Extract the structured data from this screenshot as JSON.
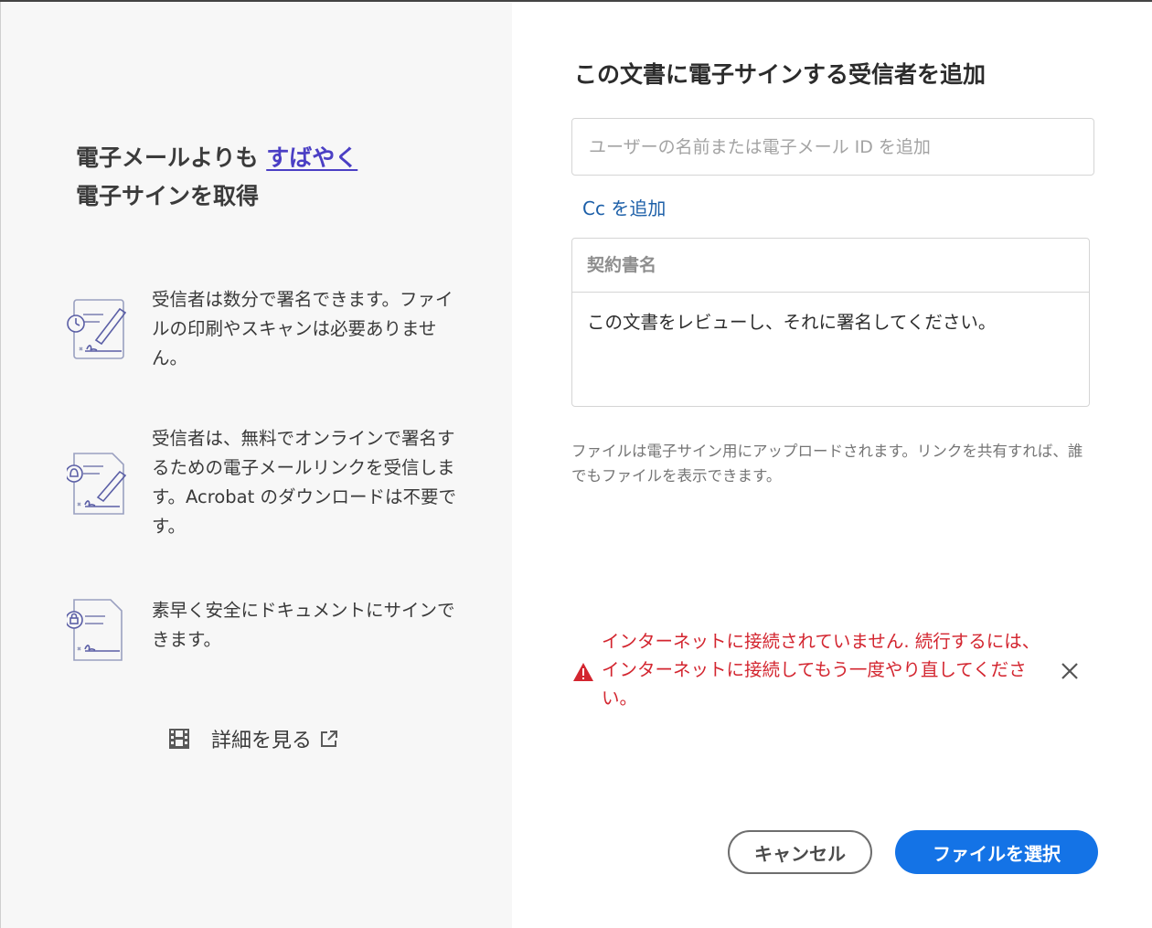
{
  "left": {
    "headline_prefix": "電子メールよりも ",
    "headline_highlight": "すばやく",
    "headline_line2": "電子サインを取得",
    "features": [
      {
        "icon": "clock-sign-document-icon",
        "text": "受信者は数分で署名できます。ファイルの印刷やスキャンは必要ありません。"
      },
      {
        "icon": "bell-sign-document-icon",
        "text": "受信者は、無料でオンラインで署名するための電子メールリンクを受信します。Acrobat のダウンロードは不要です。"
      },
      {
        "icon": "lock-sign-document-icon",
        "text": "素早く安全にドキュメントにサインできます。"
      }
    ],
    "learn_more": "詳細を見る"
  },
  "right": {
    "title": "この文書に電子サインする受信者を追加",
    "recipient_placeholder": "ユーザーの名前または電子メール ID を追加",
    "add_cc": "Cc を追加",
    "agreement_name_label": "契約書名",
    "message": "この文書をレビューし、それに署名してください。",
    "note": "ファイルは電子サイン用にアップロードされます。リンクを共有すれば、誰でもファイルを表示できます。",
    "error": "インターネットに接続されていません. 続行するには、インターネットに接続してもう一度やり直してください。",
    "cancel_label": "キャンセル",
    "select_file_label": "ファイルを選択"
  },
  "colors": {
    "highlight": "#4b3fc4",
    "link": "#1c5fa8",
    "error": "#d3252f",
    "primary_button": "#1473e6",
    "left_panel_bg": "#f7f7f7"
  }
}
